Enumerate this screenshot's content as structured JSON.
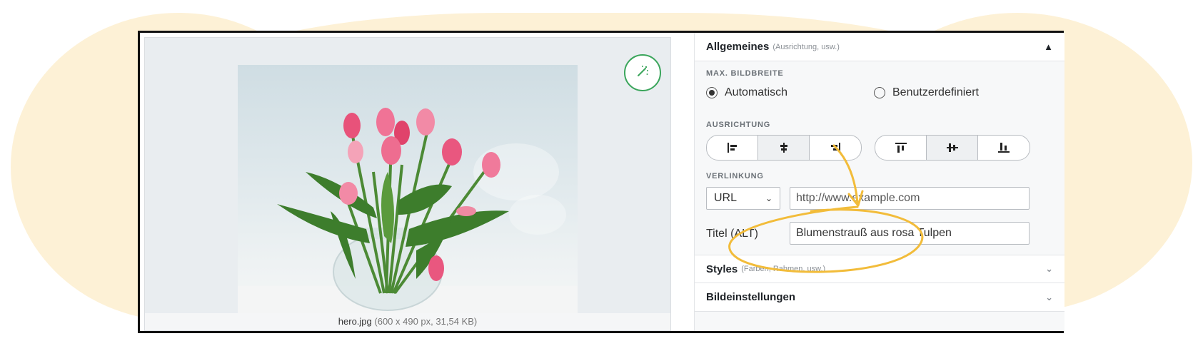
{
  "image": {
    "filename": "hero.jpg",
    "meta": "(600 x 490 px, 31,54 KB)",
    "alt": "Blumenstrauß aus rosa Tulpen"
  },
  "toolbar": {
    "magic_icon": "magic-wand-icon"
  },
  "sections": {
    "general": {
      "title": "Allgemeines",
      "hint": "(Ausrichtung, usw.)",
      "expanded": true
    },
    "styles": {
      "title": "Styles",
      "hint": "(Farben, Rahmen, usw.)",
      "expanded": false
    },
    "image_settings": {
      "title": "Bildeinstellungen",
      "expanded": false
    }
  },
  "max_width": {
    "label": "MAX. BILDBREITE",
    "options": [
      "Automatisch",
      "Benutzerdefiniert"
    ],
    "selected": "Automatisch"
  },
  "alignment": {
    "label": "AUSRICHTUNG",
    "horizontal": [
      "align-left-icon",
      "align-center-icon",
      "align-right-icon"
    ],
    "horizontal_selected": "align-center-icon",
    "vertical": [
      "align-top-icon",
      "align-middle-icon",
      "align-bottom-icon"
    ],
    "vertical_selected": "align-middle-icon"
  },
  "link": {
    "label": "VERLINKUNG",
    "type": "URL",
    "placeholder": "http://www.example.com"
  },
  "alt_field": {
    "label": "Titel (ALT)",
    "value": "Blumenstrauß aus rosa Tulpen"
  },
  "colors": {
    "background_blob": "#fdf1d6",
    "accent_green": "#3aa55b",
    "annotation_yellow": "#f2bc3a"
  }
}
